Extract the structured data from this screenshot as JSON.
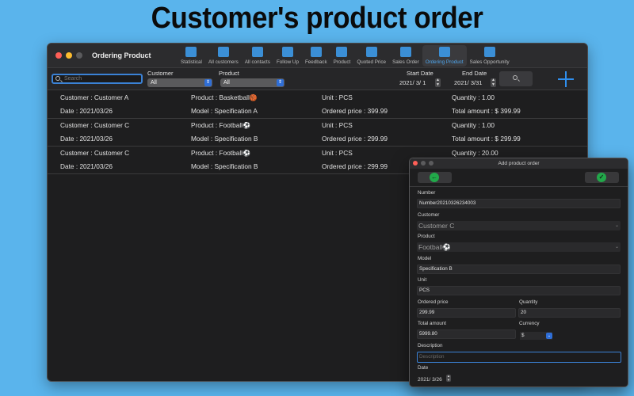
{
  "headline": "Customer's product order",
  "window": {
    "title": "Ordering Product"
  },
  "toolbar": [
    {
      "label": "Statistical",
      "icon": "chart-icon"
    },
    {
      "label": "All customers",
      "icon": "customers-icon"
    },
    {
      "label": "All contacts",
      "icon": "contacts-icon"
    },
    {
      "label": "Follow Up",
      "icon": "network-icon"
    },
    {
      "label": "Feedback",
      "icon": "feedback-icon"
    },
    {
      "label": "Product",
      "icon": "product-icon"
    },
    {
      "label": "Quoted Price",
      "icon": "calculator-icon"
    },
    {
      "label": "Sales Order",
      "icon": "order-icon"
    },
    {
      "label": "Ordering Product",
      "icon": "cart-icon",
      "active": true
    },
    {
      "label": "Sales Opportunity",
      "icon": "briefcase-icon"
    }
  ],
  "filters": {
    "search_placeholder": "Search",
    "customer_label": "Customer",
    "customer_value": "All",
    "product_label": "Product",
    "product_value": "All",
    "start_label": "Start Date",
    "start_value": "2021/  3/  1",
    "end_label": "End Date",
    "end_value": "2021/  3/31"
  },
  "orders": [
    {
      "customer": "Customer : Customer A",
      "product": "Product : Basketball",
      "product_emoji": "🏀",
      "unit": "Unit : PCS",
      "quantity": "Quantity : 1.00",
      "date": "Date : 2021/03/26",
      "model": "Model : Specification A",
      "price": "Ordered price : 399.99",
      "total": "Total amount : $ 399.99"
    },
    {
      "customer": "Customer : Customer C",
      "product": "Product : Football",
      "product_emoji": "⚽",
      "unit": "Unit : PCS",
      "quantity": "Quantity : 1.00",
      "date": "Date : 2021/03/26",
      "model": "Model : Specification B",
      "price": "Ordered price : 299.99",
      "total": "Total amount : $ 299.99"
    },
    {
      "customer": "Customer : Customer C",
      "product": "Product : Football",
      "product_emoji": "⚽",
      "unit": "Unit : PCS",
      "quantity": "Quantity : 20.00",
      "date": "Date : 2021/03/26",
      "model": "Model : Specification B",
      "price": "Ordered price : 299.99",
      "total": ""
    }
  ],
  "dialog": {
    "title": "Add product order",
    "number_label": "Number",
    "number_value": "Number20210326234003",
    "customer_label": "Customer",
    "customer_value": "Customer C",
    "product_label": "Product",
    "product_value": "Football⚽",
    "model_label": "Model",
    "model_value": "Specification B",
    "unit_label": "Unit",
    "unit_value": "PCS",
    "price_label": "Ordered price",
    "price_value": "299.99",
    "quantity_label": "Quantity",
    "quantity_value": "20",
    "total_label": "Total amount",
    "total_value": "5999.80",
    "currency_label": "Currency",
    "currency_value": "$",
    "description_label": "Description",
    "description_placeholder": "Description",
    "date_label": "Date",
    "date_value": "2021/  3/26"
  },
  "colors": {
    "background": "#5ab4ec",
    "accent": "#2f8fef",
    "confirm": "#22a84a"
  }
}
